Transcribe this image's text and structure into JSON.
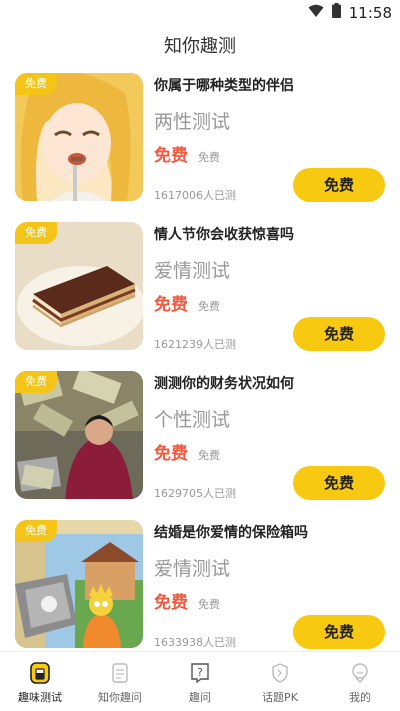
{
  "status_bar": {
    "time": "11:58",
    "wifi_icon": "wifi-icon",
    "battery_icon": "battery-icon"
  },
  "header": {
    "title": "知你趣测"
  },
  "tests": [
    {
      "tag": "免费",
      "title": "你属于哪种类型的伴侣",
      "category": "两性测试",
      "price": "免费",
      "original_price": "免费",
      "count": "1617006人已测",
      "button": "免费"
    },
    {
      "tag": "免费",
      "title": "情人节你会收获惊喜吗",
      "category": "爱情测试",
      "price": "免费",
      "original_price": "免费",
      "count": "1621239人已测",
      "button": "免费"
    },
    {
      "tag": "免费",
      "title": "测测你的财务状况如何",
      "category": "个性测试",
      "price": "免费",
      "original_price": "免费",
      "count": "1629705人已测",
      "button": "免费"
    },
    {
      "tag": "免费",
      "title": "结婚是你爱情的保险箱吗",
      "category": "爱情测试",
      "price": "免费",
      "original_price": "免费",
      "count": "1633938人已测",
      "button": "免费"
    }
  ],
  "tabs": [
    {
      "label": "趣味测试",
      "icon": "test-cup-icon",
      "active": true
    },
    {
      "label": "知你趣问",
      "icon": "document-icon",
      "active": false
    },
    {
      "label": "趣问",
      "icon": "question-icon",
      "active": false
    },
    {
      "label": "话题PK",
      "icon": "shield-icon",
      "active": false
    },
    {
      "label": "我的",
      "icon": "profile-icon",
      "active": false
    }
  ],
  "colors": {
    "accent": "#f7c911",
    "price": "#f25a3f",
    "muted": "#999999"
  }
}
